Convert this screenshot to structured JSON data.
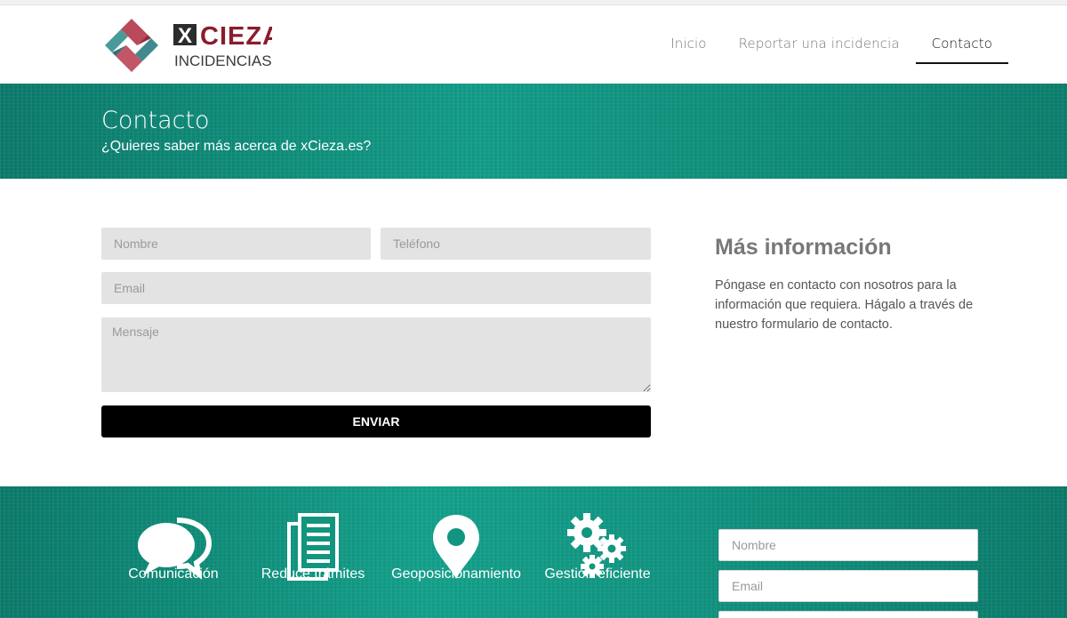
{
  "brand": {
    "name": "CIEZA",
    "subname": "INCIDENCIAS",
    "mark": "X",
    "color_primary": "#8b1c2c",
    "color_secondary": "#3a3a3a",
    "color_teal": "#0f8f7d"
  },
  "nav": {
    "items": [
      {
        "label": "Inicio",
        "active": false
      },
      {
        "label": "Reportar una incidencia",
        "active": false
      },
      {
        "label": "Contacto",
        "active": true
      }
    ]
  },
  "banner": {
    "title": "Contacto",
    "subtitle": "¿Quieres saber más acerca de xCieza.es?"
  },
  "form": {
    "name_placeholder": "Nombre",
    "phone_placeholder": "Teléfono",
    "email_placeholder": "Email",
    "message_placeholder": "Mensaje",
    "submit_label": "ENVIAR"
  },
  "info": {
    "title": "Más información",
    "text": "Póngase en contacto con nosotros para la información que requiera. Hágalo a través de nuestro formulario de contacto."
  },
  "footer": {
    "features": [
      {
        "label": "Comunicación",
        "icon": "speech-bubbles-icon"
      },
      {
        "label": "Reduce trámites",
        "icon": "documents-icon"
      },
      {
        "label": "Geoposicionamiento",
        "icon": "map-pin-icon"
      },
      {
        "label": "Gestión eficiente",
        "icon": "gears-icon"
      }
    ],
    "form": {
      "name_placeholder": "Nombre",
      "email_placeholder": "Email"
    }
  }
}
